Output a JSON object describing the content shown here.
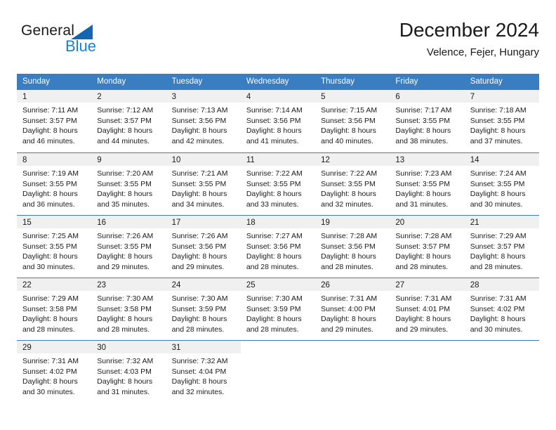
{
  "brand": {
    "word_general": "General",
    "word_blue": "Blue",
    "triangle_color": "#1566b0",
    "blue_color": "#1a7fd4"
  },
  "header": {
    "title": "December 2024",
    "subtitle": "Velence, Fejer, Hungary"
  },
  "theme": {
    "header_row_bg": "#3a7dc0",
    "day_band_bg": "#f0f0f0",
    "grid_line": "#3a7dc0"
  },
  "weekdays": [
    "Sunday",
    "Monday",
    "Tuesday",
    "Wednesday",
    "Thursday",
    "Friday",
    "Saturday"
  ],
  "weeks": [
    [
      {
        "day": "1",
        "sunrise": "Sunrise: 7:11 AM",
        "sunset": "Sunset: 3:57 PM",
        "daylight1": "Daylight: 8 hours",
        "daylight2": "and 46 minutes."
      },
      {
        "day": "2",
        "sunrise": "Sunrise: 7:12 AM",
        "sunset": "Sunset: 3:57 PM",
        "daylight1": "Daylight: 8 hours",
        "daylight2": "and 44 minutes."
      },
      {
        "day": "3",
        "sunrise": "Sunrise: 7:13 AM",
        "sunset": "Sunset: 3:56 PM",
        "daylight1": "Daylight: 8 hours",
        "daylight2": "and 42 minutes."
      },
      {
        "day": "4",
        "sunrise": "Sunrise: 7:14 AM",
        "sunset": "Sunset: 3:56 PM",
        "daylight1": "Daylight: 8 hours",
        "daylight2": "and 41 minutes."
      },
      {
        "day": "5",
        "sunrise": "Sunrise: 7:15 AM",
        "sunset": "Sunset: 3:56 PM",
        "daylight1": "Daylight: 8 hours",
        "daylight2": "and 40 minutes."
      },
      {
        "day": "6",
        "sunrise": "Sunrise: 7:17 AM",
        "sunset": "Sunset: 3:55 PM",
        "daylight1": "Daylight: 8 hours",
        "daylight2": "and 38 minutes."
      },
      {
        "day": "7",
        "sunrise": "Sunrise: 7:18 AM",
        "sunset": "Sunset: 3:55 PM",
        "daylight1": "Daylight: 8 hours",
        "daylight2": "and 37 minutes."
      }
    ],
    [
      {
        "day": "8",
        "sunrise": "Sunrise: 7:19 AM",
        "sunset": "Sunset: 3:55 PM",
        "daylight1": "Daylight: 8 hours",
        "daylight2": "and 36 minutes."
      },
      {
        "day": "9",
        "sunrise": "Sunrise: 7:20 AM",
        "sunset": "Sunset: 3:55 PM",
        "daylight1": "Daylight: 8 hours",
        "daylight2": "and 35 minutes."
      },
      {
        "day": "10",
        "sunrise": "Sunrise: 7:21 AM",
        "sunset": "Sunset: 3:55 PM",
        "daylight1": "Daylight: 8 hours",
        "daylight2": "and 34 minutes."
      },
      {
        "day": "11",
        "sunrise": "Sunrise: 7:22 AM",
        "sunset": "Sunset: 3:55 PM",
        "daylight1": "Daylight: 8 hours",
        "daylight2": "and 33 minutes."
      },
      {
        "day": "12",
        "sunrise": "Sunrise: 7:22 AM",
        "sunset": "Sunset: 3:55 PM",
        "daylight1": "Daylight: 8 hours",
        "daylight2": "and 32 minutes."
      },
      {
        "day": "13",
        "sunrise": "Sunrise: 7:23 AM",
        "sunset": "Sunset: 3:55 PM",
        "daylight1": "Daylight: 8 hours",
        "daylight2": "and 31 minutes."
      },
      {
        "day": "14",
        "sunrise": "Sunrise: 7:24 AM",
        "sunset": "Sunset: 3:55 PM",
        "daylight1": "Daylight: 8 hours",
        "daylight2": "and 30 minutes."
      }
    ],
    [
      {
        "day": "15",
        "sunrise": "Sunrise: 7:25 AM",
        "sunset": "Sunset: 3:55 PM",
        "daylight1": "Daylight: 8 hours",
        "daylight2": "and 30 minutes."
      },
      {
        "day": "16",
        "sunrise": "Sunrise: 7:26 AM",
        "sunset": "Sunset: 3:55 PM",
        "daylight1": "Daylight: 8 hours",
        "daylight2": "and 29 minutes."
      },
      {
        "day": "17",
        "sunrise": "Sunrise: 7:26 AM",
        "sunset": "Sunset: 3:56 PM",
        "daylight1": "Daylight: 8 hours",
        "daylight2": "and 29 minutes."
      },
      {
        "day": "18",
        "sunrise": "Sunrise: 7:27 AM",
        "sunset": "Sunset: 3:56 PM",
        "daylight1": "Daylight: 8 hours",
        "daylight2": "and 28 minutes."
      },
      {
        "day": "19",
        "sunrise": "Sunrise: 7:28 AM",
        "sunset": "Sunset: 3:56 PM",
        "daylight1": "Daylight: 8 hours",
        "daylight2": "and 28 minutes."
      },
      {
        "day": "20",
        "sunrise": "Sunrise: 7:28 AM",
        "sunset": "Sunset: 3:57 PM",
        "daylight1": "Daylight: 8 hours",
        "daylight2": "and 28 minutes."
      },
      {
        "day": "21",
        "sunrise": "Sunrise: 7:29 AM",
        "sunset": "Sunset: 3:57 PM",
        "daylight1": "Daylight: 8 hours",
        "daylight2": "and 28 minutes."
      }
    ],
    [
      {
        "day": "22",
        "sunrise": "Sunrise: 7:29 AM",
        "sunset": "Sunset: 3:58 PM",
        "daylight1": "Daylight: 8 hours",
        "daylight2": "and 28 minutes."
      },
      {
        "day": "23",
        "sunrise": "Sunrise: 7:30 AM",
        "sunset": "Sunset: 3:58 PM",
        "daylight1": "Daylight: 8 hours",
        "daylight2": "and 28 minutes."
      },
      {
        "day": "24",
        "sunrise": "Sunrise: 7:30 AM",
        "sunset": "Sunset: 3:59 PM",
        "daylight1": "Daylight: 8 hours",
        "daylight2": "and 28 minutes."
      },
      {
        "day": "25",
        "sunrise": "Sunrise: 7:30 AM",
        "sunset": "Sunset: 3:59 PM",
        "daylight1": "Daylight: 8 hours",
        "daylight2": "and 28 minutes."
      },
      {
        "day": "26",
        "sunrise": "Sunrise: 7:31 AM",
        "sunset": "Sunset: 4:00 PM",
        "daylight1": "Daylight: 8 hours",
        "daylight2": "and 29 minutes."
      },
      {
        "day": "27",
        "sunrise": "Sunrise: 7:31 AM",
        "sunset": "Sunset: 4:01 PM",
        "daylight1": "Daylight: 8 hours",
        "daylight2": "and 29 minutes."
      },
      {
        "day": "28",
        "sunrise": "Sunrise: 7:31 AM",
        "sunset": "Sunset: 4:02 PM",
        "daylight1": "Daylight: 8 hours",
        "daylight2": "and 30 minutes."
      }
    ],
    [
      {
        "day": "29",
        "sunrise": "Sunrise: 7:31 AM",
        "sunset": "Sunset: 4:02 PM",
        "daylight1": "Daylight: 8 hours",
        "daylight2": "and 30 minutes."
      },
      {
        "day": "30",
        "sunrise": "Sunrise: 7:32 AM",
        "sunset": "Sunset: 4:03 PM",
        "daylight1": "Daylight: 8 hours",
        "daylight2": "and 31 minutes."
      },
      {
        "day": "31",
        "sunrise": "Sunrise: 7:32 AM",
        "sunset": "Sunset: 4:04 PM",
        "daylight1": "Daylight: 8 hours",
        "daylight2": "and 32 minutes."
      },
      {
        "day": "",
        "sunrise": "",
        "sunset": "",
        "daylight1": "",
        "daylight2": ""
      },
      {
        "day": "",
        "sunrise": "",
        "sunset": "",
        "daylight1": "",
        "daylight2": ""
      },
      {
        "day": "",
        "sunrise": "",
        "sunset": "",
        "daylight1": "",
        "daylight2": ""
      },
      {
        "day": "",
        "sunrise": "",
        "sunset": "",
        "daylight1": "",
        "daylight2": ""
      }
    ]
  ]
}
